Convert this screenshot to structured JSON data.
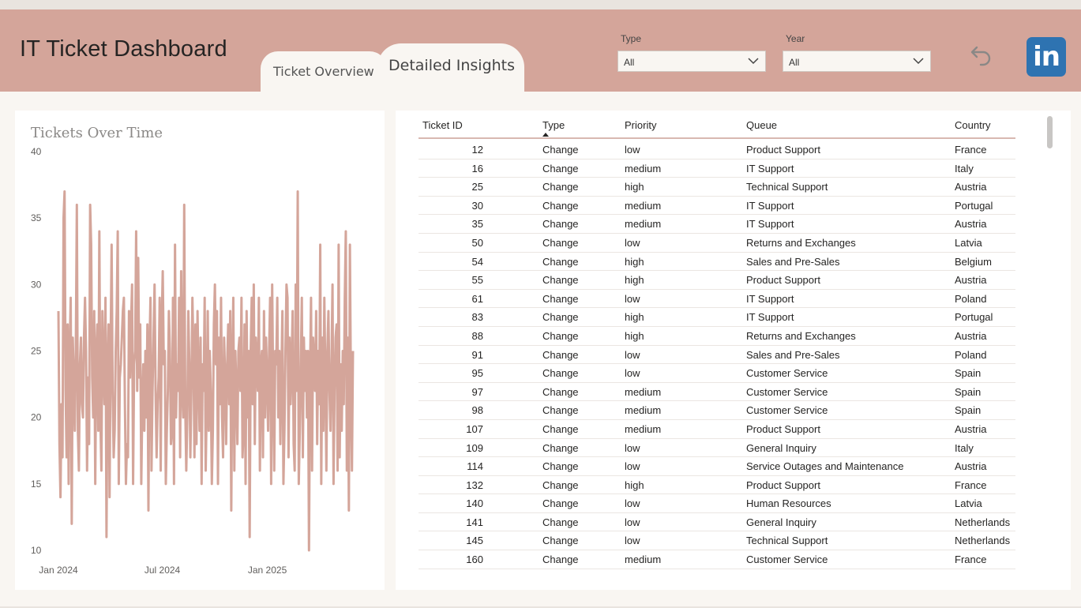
{
  "header": {
    "title": "IT Ticket Dashboard",
    "tabs": [
      {
        "label": "Ticket Overview",
        "active": false
      },
      {
        "label": "Detailed Insights",
        "active": true
      }
    ],
    "filters": {
      "type": {
        "label": "Type",
        "value": "All"
      },
      "year": {
        "label": "Year",
        "value": "All"
      }
    },
    "icons": [
      "back-arrow-icon",
      "linkedin-icon"
    ],
    "linkedin_text": "in"
  },
  "colors": {
    "header_bg": "#d4a59a",
    "page_bg": "#f9f6f2",
    "line": "#d4a59a",
    "linkedin": "#2e73b1"
  },
  "chart_data": {
    "type": "line",
    "title": "Tickets Over Time",
    "xlabel": "",
    "ylabel": "",
    "ylim": [
      10,
      40
    ],
    "yticks": [
      10,
      15,
      20,
      25,
      30,
      35,
      40
    ],
    "x_tick_labels": [
      "Jan 2024",
      "Jul 2024",
      "Jan 2025"
    ],
    "x_start": "2024-01-01",
    "x_end": "2025-05-31",
    "grid": false,
    "series": [
      {
        "values": [
          28,
          18,
          14,
          21,
          17,
          35,
          37,
          22,
          17,
          27,
          15,
          25,
          29,
          12,
          26,
          23,
          19,
          25,
          36,
          19,
          16,
          24,
          26,
          21,
          20,
          26,
          29,
          25,
          16,
          23,
          18,
          36,
          33,
          23,
          20,
          28,
          15,
          25,
          27,
          19,
          34,
          20,
          16,
          28,
          24,
          21,
          29,
          11,
          24,
          27,
          14,
          25,
          33,
          22,
          17,
          19,
          25,
          28,
          34,
          15,
          23,
          24,
          26,
          28,
          29,
          21,
          15,
          18,
          17,
          28,
          23,
          27,
          30,
          15,
          24,
          25,
          34,
          22,
          32,
          23,
          27,
          15,
          21,
          24,
          19,
          25,
          20,
          27,
          13,
          25,
          29,
          16,
          22,
          26,
          30,
          22,
          17,
          21,
          23,
          29,
          16,
          27,
          31,
          24,
          25,
          15,
          19,
          22,
          28,
          25,
          18,
          19,
          29,
          15,
          33,
          20,
          24,
          22,
          29,
          17,
          31,
          22,
          20,
          36,
          21,
          16,
          20,
          28,
          24,
          17,
          22,
          29,
          25,
          17,
          27,
          18,
          28,
          23,
          19,
          26,
          15,
          24,
          22,
          29,
          16,
          21,
          28,
          19,
          25,
          22,
          15,
          19,
          27,
          30,
          24,
          28,
          15,
          26,
          21,
          29,
          20,
          17,
          26,
          23,
          18,
          24,
          27,
          21,
          28,
          13,
          24,
          29,
          16,
          25,
          22,
          18,
          25,
          26,
          22,
          29,
          17,
          19,
          27,
          15,
          28,
          20,
          25,
          11,
          25,
          29,
          21,
          30,
          18,
          26,
          24,
          22,
          29,
          16,
          24,
          25,
          17,
          28,
          20,
          26,
          23,
          19,
          25,
          29,
          15,
          30,
          22,
          16,
          25,
          24,
          29,
          20,
          25,
          18,
          23,
          28,
          15,
          19,
          25,
          30,
          29,
          17,
          26,
          21,
          24,
          28,
          18,
          16,
          30,
          22,
          37,
          15,
          19,
          24,
          29,
          17,
          26,
          22,
          25,
          20,
          25,
          10,
          23,
          29,
          16,
          26,
          24,
          22,
          28,
          18,
          25,
          21,
          33,
          15,
          26,
          19,
          29,
          23,
          16,
          25,
          28,
          22,
          19,
          24,
          30,
          15,
          22,
          26,
          27,
          16,
          33,
          17,
          24,
          19,
          25,
          21,
          29,
          34,
          16,
          26,
          13,
          33,
          22,
          16,
          25
        ]
      }
    ]
  },
  "table": {
    "columns": [
      "Ticket ID",
      "Type",
      "Priority",
      "Queue",
      "Country"
    ],
    "sorted_column": "Type",
    "rows": [
      [
        "12",
        "Change",
        "low",
        "Product Support",
        "France"
      ],
      [
        "16",
        "Change",
        "medium",
        "IT Support",
        "Italy"
      ],
      [
        "25",
        "Change",
        "high",
        "Technical Support",
        "Austria"
      ],
      [
        "30",
        "Change",
        "medium",
        "IT Support",
        "Portugal"
      ],
      [
        "35",
        "Change",
        "medium",
        "IT Support",
        "Austria"
      ],
      [
        "50",
        "Change",
        "low",
        "Returns and Exchanges",
        "Latvia"
      ],
      [
        "54",
        "Change",
        "high",
        "Sales and Pre-Sales",
        "Belgium"
      ],
      [
        "55",
        "Change",
        "high",
        "Product Support",
        "Austria"
      ],
      [
        "61",
        "Change",
        "low",
        "IT Support",
        "Poland"
      ],
      [
        "83",
        "Change",
        "high",
        "IT Support",
        "Portugal"
      ],
      [
        "88",
        "Change",
        "high",
        "Returns and Exchanges",
        "Austria"
      ],
      [
        "91",
        "Change",
        "low",
        "Sales and Pre-Sales",
        "Poland"
      ],
      [
        "95",
        "Change",
        "low",
        "Customer Service",
        "Spain"
      ],
      [
        "97",
        "Change",
        "medium",
        "Customer Service",
        "Spain"
      ],
      [
        "98",
        "Change",
        "medium",
        "Customer Service",
        "Spain"
      ],
      [
        "107",
        "Change",
        "medium",
        "Product Support",
        "Austria"
      ],
      [
        "109",
        "Change",
        "low",
        "General Inquiry",
        "Italy"
      ],
      [
        "114",
        "Change",
        "low",
        "Service Outages and Maintenance",
        "Austria"
      ],
      [
        "132",
        "Change",
        "high",
        "Product Support",
        "France"
      ],
      [
        "140",
        "Change",
        "low",
        "Human Resources",
        "Latvia"
      ],
      [
        "141",
        "Change",
        "low",
        "General Inquiry",
        "Netherlands"
      ],
      [
        "145",
        "Change",
        "low",
        "Technical Support",
        "Netherlands"
      ],
      [
        "160",
        "Change",
        "medium",
        "Customer Service",
        "France"
      ]
    ]
  }
}
